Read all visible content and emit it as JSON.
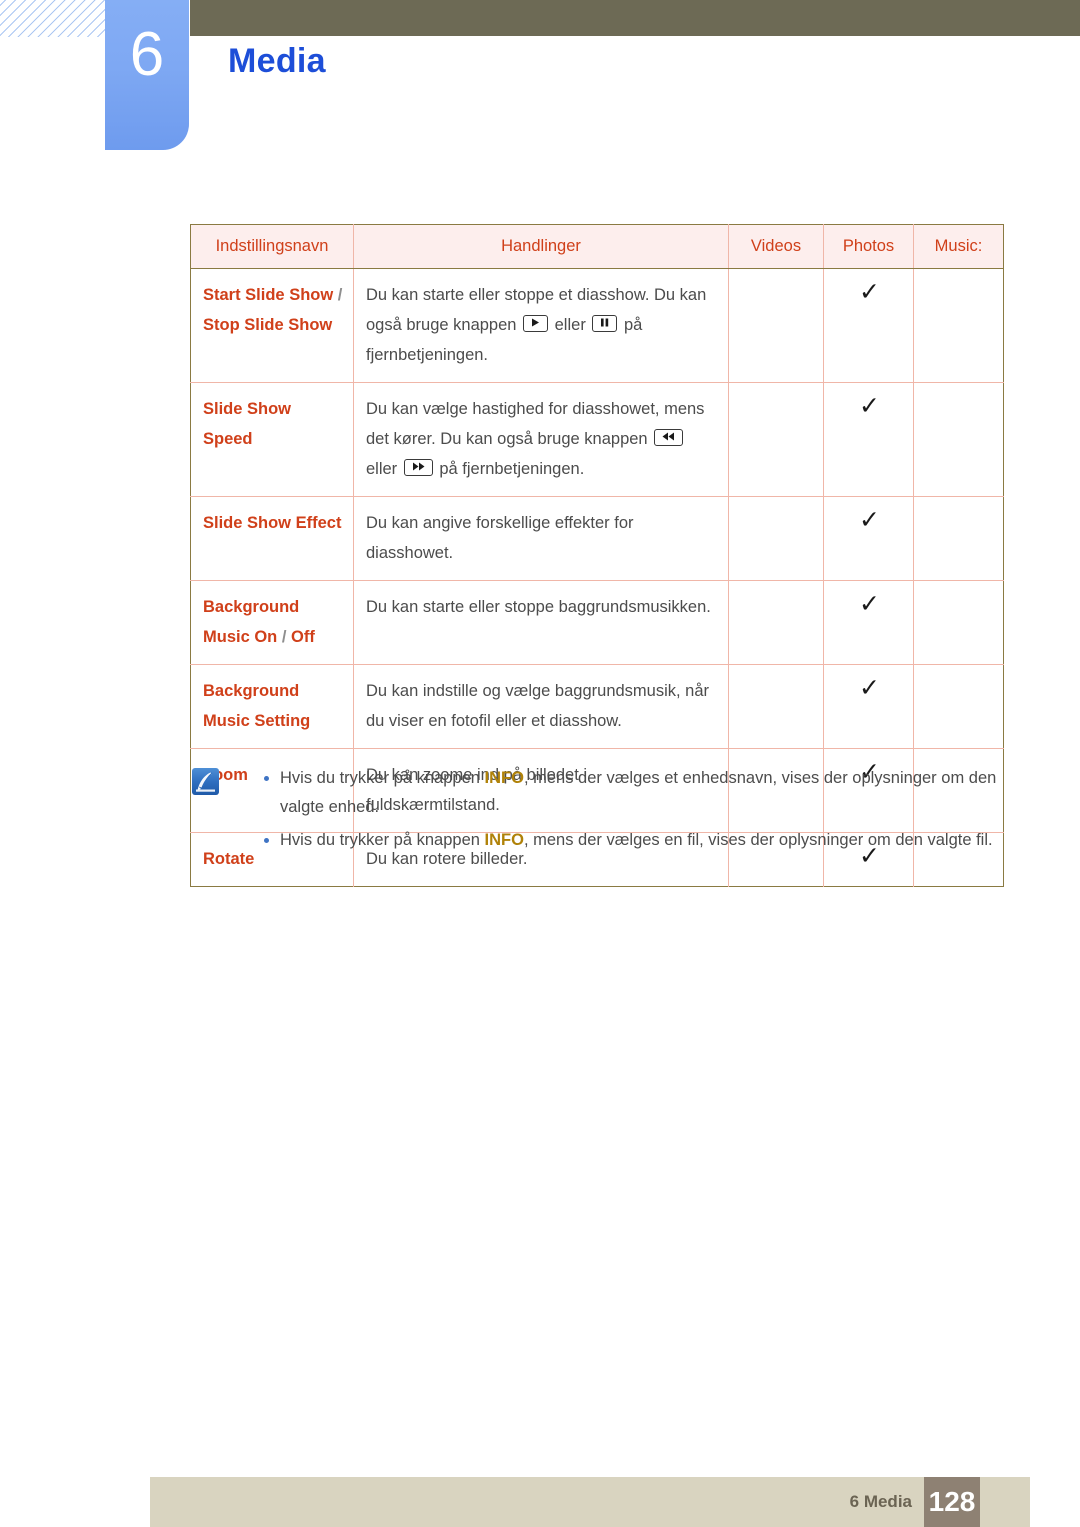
{
  "chapter": {
    "number": "6",
    "title": "Media"
  },
  "table": {
    "headers": [
      "Indstillingsnavn",
      "Handlinger",
      "Videos",
      "Photos",
      "Music:"
    ],
    "rows": [
      {
        "name_parts": [
          "Start Slide Show",
          "/",
          "Stop Slide Show"
        ],
        "action_pre": "Du kan starte eller stoppe et diasshow. Du kan også bruge knappen",
        "action_mid": "eller",
        "action_post": "på fjernbetjeningen.",
        "icon1": "play-icon",
        "icon2": "pause-icon",
        "videos": "",
        "photos": "✓",
        "music": ""
      },
      {
        "name_parts": [
          "Slide Show Speed"
        ],
        "action_pre": "Du kan vælge hastighed for diasshowet, mens det kører. Du kan også bruge knappen",
        "action_mid": "eller",
        "action_post": "på fjernbetjeningen.",
        "icon1": "rewind-icon",
        "icon2": "fast-forward-icon",
        "videos": "",
        "photos": "✓",
        "music": ""
      },
      {
        "name_parts": [
          "Slide Show Effect"
        ],
        "action_pre": "Du kan angive forskellige effekter for diasshowet.",
        "action_mid": "",
        "action_post": "",
        "icon1": "",
        "icon2": "",
        "videos": "",
        "photos": "✓",
        "music": ""
      },
      {
        "name_parts": [
          "Background Music On",
          "/",
          "Off"
        ],
        "action_pre": "Du kan starte eller stoppe baggrundsmusikken.",
        "action_mid": "",
        "action_post": "",
        "icon1": "",
        "icon2": "",
        "videos": "",
        "photos": "✓",
        "music": ""
      },
      {
        "name_parts": [
          "Background Music Setting"
        ],
        "action_pre": "Du kan indstille og vælge baggrundsmusik, når du viser en fotofil eller et diasshow.",
        "action_mid": "",
        "action_post": "",
        "icon1": "",
        "icon2": "",
        "videos": "",
        "photos": "✓",
        "music": ""
      },
      {
        "name_parts": [
          "Zoom"
        ],
        "action_pre": "Du kan zoome ind på billedet i fuldskærmtilstand.",
        "action_mid": "",
        "action_post": "",
        "icon1": "",
        "icon2": "",
        "videos": "",
        "photos": "✓",
        "music": ""
      },
      {
        "name_parts": [
          "Rotate"
        ],
        "action_pre": "Du kan rotere billeder.",
        "action_mid": "",
        "action_post": "",
        "icon1": "",
        "icon2": "",
        "videos": "",
        "photos": "✓",
        "music": ""
      }
    ]
  },
  "notes": {
    "icon": "note-pen-icon",
    "items": [
      {
        "pre": "Hvis du trykker på knappen ",
        "keyword": "INFO",
        "post": ", mens der vælges et enhedsnavn, vises der oplysninger om den valgte enhed."
      },
      {
        "pre": "Hvis du trykker på knappen ",
        "keyword": "INFO",
        "post": ", mens der vælges en fil, vises der oplysninger om den valgte fil."
      }
    ]
  },
  "footer": {
    "label": "6 Media",
    "page": "128"
  },
  "colors": {
    "chapter_blue": "#7ea8f3",
    "title_blue": "#1d4ed8",
    "olive_bar": "#6d6a55",
    "accent_red": "#d0401a",
    "header_bg": "#fdeeed",
    "border_outer": "#8a7a42",
    "border_inner": "#f0b6a8",
    "info_gold": "#b08209",
    "footer_bg": "#d9d4c0",
    "page_box": "#8e8173"
  }
}
